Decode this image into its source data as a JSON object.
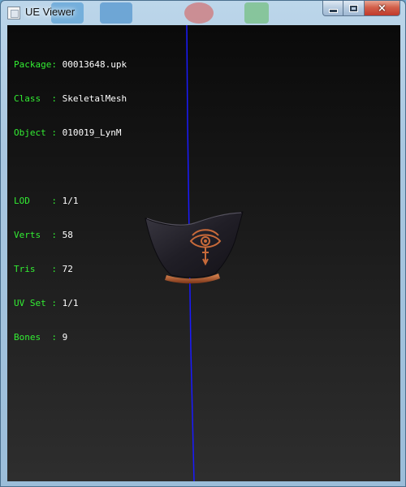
{
  "window": {
    "title": "UE Viewer",
    "minimize_glyph": "minimize-icon",
    "maximize_glyph": "maximize-icon",
    "close_glyph": "×"
  },
  "info": {
    "header": [
      {
        "label": "Package: ",
        "value": "00013648.upk"
      },
      {
        "label": "Class  : ",
        "value": "SkeletalMesh"
      },
      {
        "label": "Object : ",
        "value": "010019_LynM"
      }
    ],
    "stats": [
      {
        "label": "LOD    : ",
        "value": "1/1"
      },
      {
        "label": "Verts  : ",
        "value": "58"
      },
      {
        "label": "Tris   : ",
        "value": "72"
      },
      {
        "label": "UV Set : ",
        "value": "1/1"
      },
      {
        "label": "Bones  : ",
        "value": "9"
      }
    ]
  },
  "colors": {
    "label_green": "#33ee33",
    "value_white": "#ffffff",
    "axis_blue": "#1a1aff",
    "mesh_cloth": "#24222b",
    "mesh_trim": "#c0643a",
    "emblem": "#c86a3a"
  },
  "icons": {
    "app": "ue-viewer-app-icon",
    "mesh": "skeletal-mesh-mask"
  }
}
